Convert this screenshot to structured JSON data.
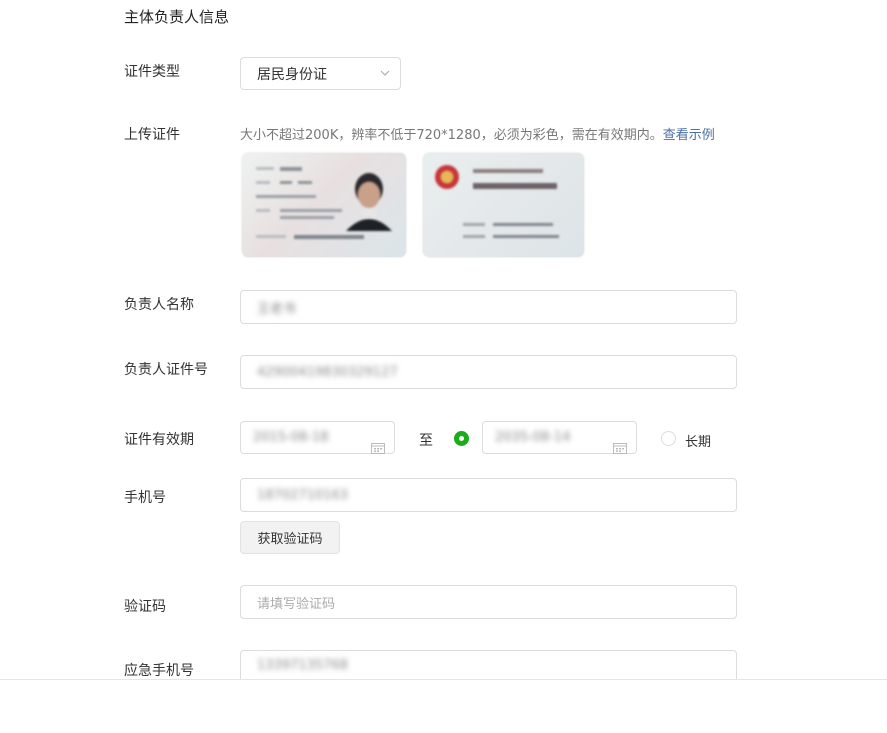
{
  "section": {
    "title": "主体负责人信息"
  },
  "cert_type": {
    "label": "证件类型",
    "value": "居民身份证"
  },
  "upload": {
    "label": "上传证件",
    "hint": "大小不超过200K，辨率不低于720*1280，必须为彩色，需在有效期内。",
    "example_link": "查看示例"
  },
  "name": {
    "label": "负责人名称",
    "value": "王老书"
  },
  "id_number": {
    "label": "负责人证件号",
    "value": "42900419830329127"
  },
  "validity": {
    "label": "证件有效期",
    "start": "2015-08-18",
    "to": "至",
    "end": "2035-08-14",
    "long_term": "长期"
  },
  "phone": {
    "label": "手机号",
    "value": "18702710163",
    "get_code": "获取验证码"
  },
  "code": {
    "label": "验证码",
    "placeholder": "请填写验证码"
  },
  "emergency": {
    "label": "应急手机号",
    "value": "13397135768"
  },
  "colors": {
    "accent_green": "#1aad19",
    "link": "#4a6fa5"
  }
}
